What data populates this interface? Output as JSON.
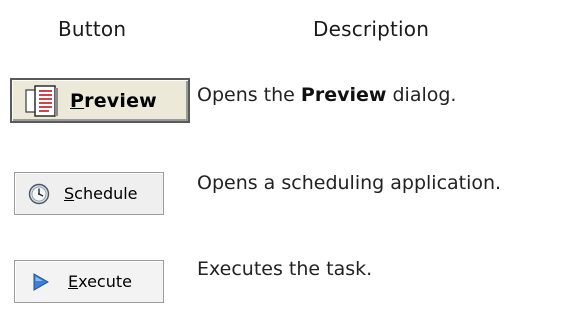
{
  "headers": {
    "button": "Button",
    "description": "Description"
  },
  "rows": [
    {
      "button": {
        "mnemonic": "P",
        "rest": "review",
        "icon": "document-preview-icon"
      },
      "description": {
        "before": "Opens the ",
        "emphasis": "Preview",
        "after": " dialog."
      }
    },
    {
      "button": {
        "mnemonic": "S",
        "rest": "chedule",
        "icon": "clock-icon"
      },
      "description": {
        "text": "Opens a scheduling application."
      }
    },
    {
      "button": {
        "mnemonic": "E",
        "rest": "xecute",
        "icon": "play-arrow-icon"
      },
      "description": {
        "text": "Executes the task."
      }
    }
  ]
}
